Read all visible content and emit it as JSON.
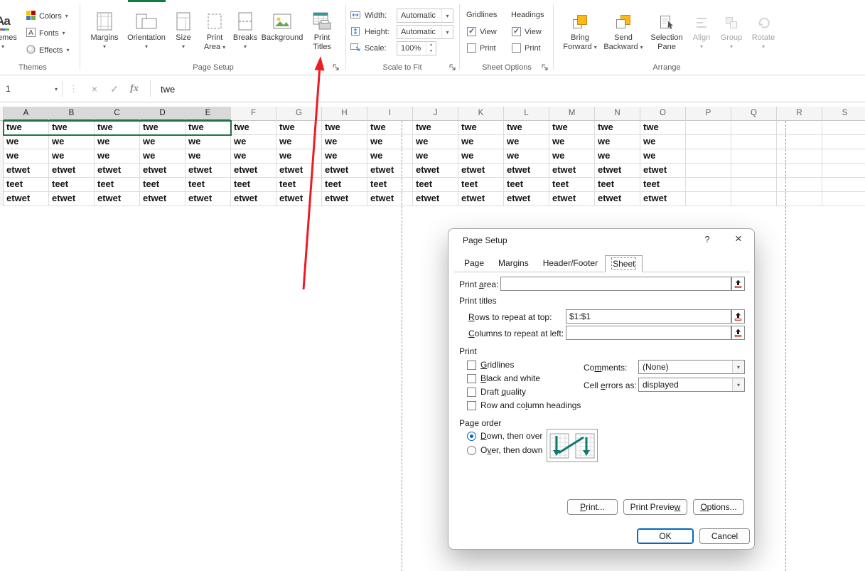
{
  "icons": {
    "caret": "▾",
    "caret_up": "▴",
    "cancel": "×",
    "enter": "✓",
    "dots": "⋮",
    "help": "?",
    "close": "×",
    "name_box_caret": "▾",
    "collapse": "↑"
  },
  "ribbon": {
    "themes": {
      "group_label": "Themes",
      "themes_button_label": "Themes",
      "themes_icon_text": "Aa",
      "colors_label": "Colors",
      "fonts_label": "Fonts",
      "effects_label": "Effects"
    },
    "page_setup": {
      "group_label": "Page Setup",
      "margins_label": "Margins",
      "orientation_label": "Orientation",
      "size_label": "Size",
      "print_area_label": "Print Area",
      "breaks_label": "Breaks",
      "background_label": "Background",
      "print_titles_label": "Print Titles"
    },
    "scale_to_fit": {
      "group_label": "Scale to Fit",
      "width_label": "Width:",
      "width_value": "Automatic",
      "height_label": "Height:",
      "height_value": "Automatic",
      "scale_label": "Scale:",
      "scale_value": "100%"
    },
    "sheet_options": {
      "group_label": "Sheet Options",
      "gridlines_header": "Gridlines",
      "headings_header": "Headings",
      "view_label": "View",
      "print_label": "Print",
      "gridlines_view_checked": true,
      "gridlines_print_checked": false,
      "headings_view_checked": true,
      "headings_print_checked": false
    },
    "arrange": {
      "group_label": "Arrange",
      "bring_forward_label": "Bring Forward",
      "send_backward_label": "Send Backward",
      "selection_pane_label": "Selection Pane",
      "align_label": "Align",
      "group_button_label": "Group",
      "rotate_label": "Rotate"
    }
  },
  "formula_bar": {
    "name_box_value": "1",
    "fx_label": "fx",
    "value": "twe"
  },
  "grid": {
    "columns": [
      "A",
      "B",
      "C",
      "D",
      "E",
      "F",
      "G",
      "H",
      "I",
      "J",
      "K",
      "L",
      "M",
      "N",
      "O",
      "P",
      "Q",
      "R",
      "S"
    ],
    "selected_columns": [
      "A",
      "B",
      "C",
      "D",
      "E"
    ],
    "selected_range": "A1:E1",
    "rows": [
      [
        "twe",
        "twe",
        "twe",
        "twe",
        "twe",
        "twe",
        "twe",
        "twe",
        "twe",
        "twe",
        "twe",
        "twe",
        "twe",
        "twe",
        "twe",
        "",
        "",
        "",
        ""
      ],
      [
        "we",
        "we",
        "we",
        "we",
        "we",
        "we",
        "we",
        "we",
        "we",
        "we",
        "we",
        "we",
        "we",
        "we",
        "we",
        "",
        "",
        "",
        ""
      ],
      [
        "we",
        "we",
        "we",
        "we",
        "we",
        "we",
        "we",
        "we",
        "we",
        "we",
        "we",
        "we",
        "we",
        "we",
        "we",
        "",
        "",
        "",
        ""
      ],
      [
        "etwet",
        "etwet",
        "etwet",
        "etwet",
        "etwet",
        "etwet",
        "etwet",
        "etwet",
        "etwet",
        "etwet",
        "etwet",
        "etwet",
        "etwet",
        "etwet",
        "etwet",
        "",
        "",
        "",
        ""
      ],
      [
        "teet",
        "teet",
        "teet",
        "teet",
        "teet",
        "teet",
        "teet",
        "teet",
        "teet",
        "teet",
        "teet",
        "teet",
        "teet",
        "teet",
        "teet",
        "",
        "",
        "",
        ""
      ],
      [
        "etwet",
        "etwet",
        "etwet",
        "etwet",
        "etwet",
        "etwet",
        "etwet",
        "etwet",
        "etwet",
        "etwet",
        "etwet",
        "etwet",
        "etwet",
        "etwet",
        "etwet",
        "",
        "",
        "",
        ""
      ]
    ]
  },
  "dialog": {
    "title": "Page Setup",
    "tabs": [
      "Page",
      "Margins",
      "Header/Footer",
      "Sheet"
    ],
    "active_tab": "Sheet",
    "print_area_label": "Print [a]rea:",
    "print_area_value": "",
    "print_titles_label": "Print titles",
    "rows_repeat_label": "[R]ows to repeat at top:",
    "rows_repeat_value": "$1:$1",
    "cols_repeat_label": "[C]olumns to repeat at left:",
    "cols_repeat_value": "",
    "print_label": "Print",
    "checkboxes": [
      {
        "label": "[G]ridlines",
        "checked": false
      },
      {
        "label": "[B]lack and white",
        "checked": false
      },
      {
        "label": "Draft [q]uality",
        "checked": false
      },
      {
        "label": "Row and co[l]umn headings",
        "checked": false
      }
    ],
    "comments_label": "Co[m]ments:",
    "comments_value": "(None)",
    "cell_errors_label": "Cell [e]rrors as:",
    "cell_errors_value": "displayed",
    "page_order_label": "Page order",
    "radios": [
      {
        "label": "[D]own, then over",
        "selected": true
      },
      {
        "label": "O[v]er, then down",
        "selected": false
      }
    ],
    "buttons": {
      "print": "[P]rint...",
      "print_preview": "Print Previe[w]",
      "options": "[O]ptions...",
      "ok": "OK",
      "cancel": "Cancel"
    }
  },
  "annotation": {
    "arrow_color": "#ed1c24"
  }
}
